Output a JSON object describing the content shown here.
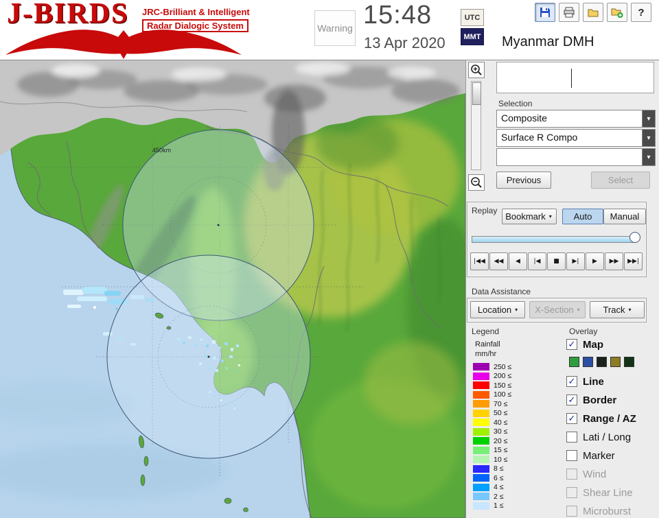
{
  "header": {
    "logo": {
      "title": "J-BIRDS",
      "tagline1": "JRC-Brilliant & Intelligent",
      "tagline2": "Radar  Dialogic  System"
    },
    "warning": "Warning",
    "clock": {
      "time": "15:48",
      "date": "13 Apr 2020"
    },
    "timezone": {
      "utc": "UTC",
      "mmt": "MMT",
      "selected": "MMT"
    },
    "station": "Myanmar DMH",
    "help": "?"
  },
  "map": {
    "range_label": "450km"
  },
  "sidebar": {
    "selection": {
      "label": "Selection",
      "dropdowns": [
        "Composite",
        "Surface R Compo",
        ""
      ],
      "previous": "Previous",
      "select": "Select"
    },
    "replay": {
      "label": "Replay",
      "bookmark": "Bookmark",
      "auto": "Auto",
      "manual": "Manual",
      "playback": [
        "|◀◀",
        "◀◀",
        "◀",
        "|◀",
        "■",
        "▶|",
        "▶",
        "▶▶",
        "▶▶|"
      ]
    },
    "data_assistance": {
      "label": "Data Assistance",
      "buttons": [
        "Location",
        "X-Section",
        "Track"
      ]
    },
    "legend": {
      "label": "Legend",
      "unit1": "Rainfall",
      "unit2": "mm/hr",
      "scale": [
        {
          "label": "250 ≤",
          "color": "#9C00B0"
        },
        {
          "label": "200 ≤",
          "color": "#E800E8"
        },
        {
          "label": "150 ≤",
          "color": "#FF0000"
        },
        {
          "label": "100 ≤",
          "color": "#FF5A00"
        },
        {
          "label": "70 ≤",
          "color": "#FF9C00"
        },
        {
          "label": "50 ≤",
          "color": "#FFD200"
        },
        {
          "label": "40 ≤",
          "color": "#FFFF00"
        },
        {
          "label": "30 ≤",
          "color": "#A0F000"
        },
        {
          "label": "20 ≤",
          "color": "#00D200"
        },
        {
          "label": "15 ≤",
          "color": "#78F078"
        },
        {
          "label": "10 ≤",
          "color": "#B4F5B4"
        },
        {
          "label": "8 ≤",
          "color": "#2828FF"
        },
        {
          "label": "6 ≤",
          "color": "#0064FF"
        },
        {
          "label": "4 ≤",
          "color": "#00A0FF"
        },
        {
          "label": "2 ≤",
          "color": "#78C8FF"
        },
        {
          "label": "1 ≤",
          "color": "#C8E6FF"
        }
      ]
    },
    "overlay": {
      "label": "Overlay",
      "items": [
        {
          "label": "Map",
          "mark": "✓"
        },
        {
          "label": "Line",
          "mark": "✓"
        },
        {
          "label": "Border",
          "mark": "✓"
        },
        {
          "label": "Range / AZ",
          "mark": "✓"
        },
        {
          "label": "Lati / Long",
          "mark": ""
        },
        {
          "label": "Marker",
          "mark": ""
        },
        {
          "label": "Wind",
          "mark": ""
        },
        {
          "label": "Shear Line",
          "mark": ""
        },
        {
          "label": "Microburst",
          "mark": ""
        }
      ],
      "swatches": [
        "#2F9E3F",
        "#2B4FA3",
        "#19231B",
        "#8F7D26",
        "#123315"
      ]
    }
  }
}
